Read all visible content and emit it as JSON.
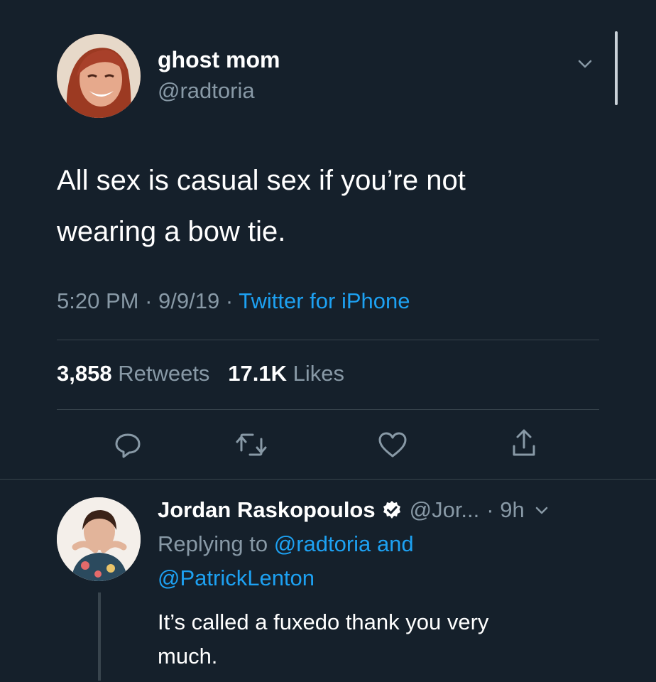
{
  "tweet": {
    "author_name": "ghost mom",
    "author_handle": "@radtoria",
    "text_line1": "All sex is casual sex if you’re not",
    "text_line2": "wearing a bow tie.",
    "time": "5:20 PM",
    "sep1": "·",
    "date": "9/9/19",
    "sep2": "·",
    "source": "Twitter for iPhone",
    "retweets_count": "3,858",
    "retweets_label": "Retweets",
    "likes_count": "17.1K",
    "likes_label": "Likes",
    "icons": [
      "reply-icon",
      "retweet-icon",
      "like-icon",
      "share-icon",
      "chevron-down-icon"
    ]
  },
  "reply": {
    "author_name": "Jordan Raskopoulos",
    "author_handle": "@Jor...",
    "time": "· 9h",
    "replying_prefix": "Replying to",
    "replying_user1": "@radtoria",
    "replying_and": "and",
    "replying_user2": "@PatrickLenton",
    "text_line1": "It’s called a fuxedo thank you very",
    "text_line2": "much.",
    "icons": [
      "verified-icon",
      "chevron-down-icon"
    ]
  },
  "colors": {
    "background": "#15202b",
    "text": "#ffffff",
    "muted": "#8899a6",
    "link": "#1da1f2",
    "divider": "#38444d"
  }
}
